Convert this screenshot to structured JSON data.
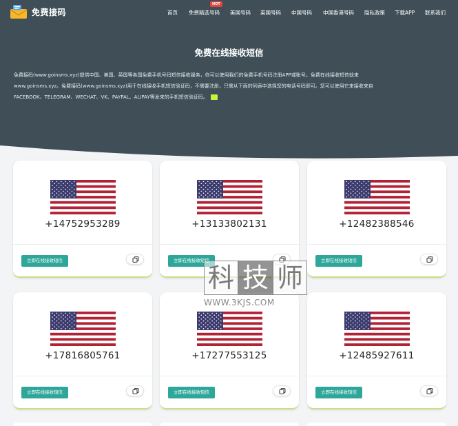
{
  "site": {
    "logo_text": "免费接码"
  },
  "nav": {
    "items": [
      {
        "label": "首页"
      },
      {
        "label": "免费精选号码"
      },
      {
        "label": "美国号码"
      },
      {
        "label": "英国号码"
      },
      {
        "label": "中国号码"
      },
      {
        "label": "中国香港号码"
      },
      {
        "label": "隐私政策"
      },
      {
        "label": "下载APP"
      },
      {
        "label": "联系我们"
      }
    ],
    "hot_badge": "HOT"
  },
  "hero": {
    "title": "免费在线接收短信",
    "description_line1": "免费接码(www.goinsms.xyz)提供中国、美国、英国等各国免费手机号码短信接收服务，你可以使用我们的免费手机号码注册APP或账号。免费在线接收短信就来",
    "description_line2": "www.goinsms.xyz。免费接码(www.goinsms.xyz)用于在线接收手机短信验证码，不需要注册，只需从下面的列表中选择您的电话号码即可。您可以使用它来接收来自",
    "description_line3": "FACEBOOK、TELEGRAM、WECHAT、VK、PAYPAL、ALIPAY等发来的手机短信验证码。"
  },
  "cards": [
    {
      "number": "+14752953289",
      "button": "立即在线接收短信",
      "flag": "us-flag-icon"
    },
    {
      "number": "+13133802131",
      "button": "立即在线接收短信",
      "flag": "us-flag-icon"
    },
    {
      "number": "+12482388546",
      "button": "立即在线接收短信",
      "flag": "us-flag-icon"
    },
    {
      "number": "+17816805761",
      "button": "立即在线接收短信",
      "flag": "us-flag-icon"
    },
    {
      "number": "+17277553125",
      "button": "立即在线接收短信",
      "flag": "us-flag-icon"
    },
    {
      "number": "+12485927611",
      "button": "立即在线接收短信",
      "flag": "us-flag-icon"
    }
  ],
  "watermark": {
    "chars": [
      "科",
      "技",
      "师"
    ],
    "url": "WWW.3KJS.COM"
  },
  "colors": {
    "hero_bg": "#3f4e57",
    "button": "#2ea79a",
    "card_accent": "#c7df85",
    "hot": "#e2453b"
  }
}
